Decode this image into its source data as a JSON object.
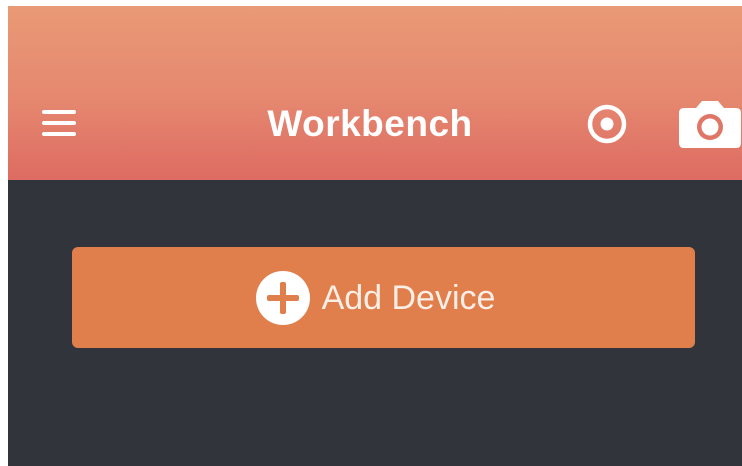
{
  "header": {
    "title": "Workbench",
    "background_top": "#e99a76",
    "background_bottom": "#dd6b62",
    "menu_icon": "hamburger-menu-icon",
    "record_icon": "record-icon",
    "camera_icon": "camera-icon"
  },
  "main": {
    "background": "#31353b",
    "add_device": {
      "label": "Add Device",
      "icon": "plus-circle-icon",
      "color": "#e07e4c"
    }
  }
}
